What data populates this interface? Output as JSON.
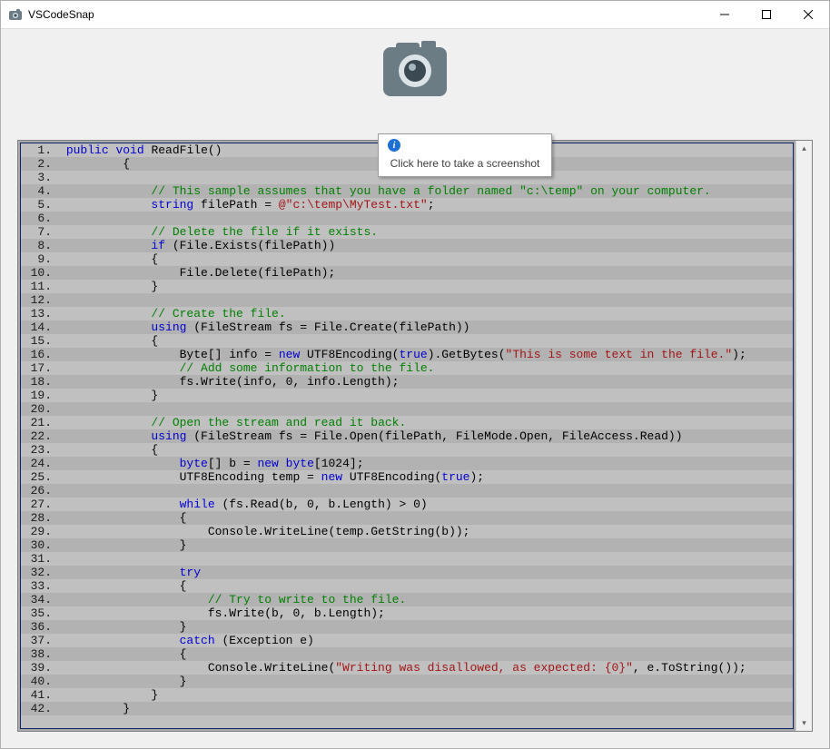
{
  "window": {
    "title": "VSCodeSnap"
  },
  "tooltip": {
    "text": "Click here to take a screenshot"
  },
  "code": {
    "lines": [
      {
        "n": 1,
        "tokens": [
          {
            "t": " ",
            "c": ""
          },
          {
            "t": "public",
            "c": "kw"
          },
          {
            "t": " ",
            "c": ""
          },
          {
            "t": "void",
            "c": "kw"
          },
          {
            "t": " ReadFile()",
            "c": ""
          }
        ]
      },
      {
        "n": 2,
        "tokens": [
          {
            "t": "         {",
            "c": ""
          }
        ]
      },
      {
        "n": 3,
        "tokens": [
          {
            "t": "",
            "c": ""
          }
        ]
      },
      {
        "n": 4,
        "tokens": [
          {
            "t": "             ",
            "c": ""
          },
          {
            "t": "// This sample assumes that you have a folder named \"c:\\temp\" on your computer.",
            "c": "cm"
          }
        ]
      },
      {
        "n": 5,
        "tokens": [
          {
            "t": "             ",
            "c": ""
          },
          {
            "t": "string",
            "c": "kw"
          },
          {
            "t": " filePath = ",
            "c": ""
          },
          {
            "t": "@\"c:\\temp\\MyTest.txt\"",
            "c": "str"
          },
          {
            "t": ";",
            "c": ""
          }
        ]
      },
      {
        "n": 6,
        "tokens": [
          {
            "t": "",
            "c": ""
          }
        ]
      },
      {
        "n": 7,
        "tokens": [
          {
            "t": "             ",
            "c": ""
          },
          {
            "t": "// Delete the file if it exists.",
            "c": "cm"
          }
        ]
      },
      {
        "n": 8,
        "tokens": [
          {
            "t": "             ",
            "c": ""
          },
          {
            "t": "if",
            "c": "kw"
          },
          {
            "t": " (File.Exists(filePath))",
            "c": ""
          }
        ]
      },
      {
        "n": 9,
        "tokens": [
          {
            "t": "             {",
            "c": ""
          }
        ]
      },
      {
        "n": 10,
        "tokens": [
          {
            "t": "                 File.Delete(filePath);",
            "c": ""
          }
        ]
      },
      {
        "n": 11,
        "tokens": [
          {
            "t": "             }",
            "c": ""
          }
        ]
      },
      {
        "n": 12,
        "tokens": [
          {
            "t": "",
            "c": ""
          }
        ]
      },
      {
        "n": 13,
        "tokens": [
          {
            "t": "             ",
            "c": ""
          },
          {
            "t": "// Create the file.",
            "c": "cm"
          }
        ]
      },
      {
        "n": 14,
        "tokens": [
          {
            "t": "             ",
            "c": ""
          },
          {
            "t": "using",
            "c": "kw"
          },
          {
            "t": " (FileStream fs = File.Create(filePath))",
            "c": ""
          }
        ]
      },
      {
        "n": 15,
        "tokens": [
          {
            "t": "             {",
            "c": ""
          }
        ]
      },
      {
        "n": 16,
        "tokens": [
          {
            "t": "                 Byte[] info = ",
            "c": ""
          },
          {
            "t": "new",
            "c": "kw"
          },
          {
            "t": " UTF8Encoding(",
            "c": ""
          },
          {
            "t": "true",
            "c": "kw"
          },
          {
            "t": ").GetBytes(",
            "c": ""
          },
          {
            "t": "\"This is some text in the file.\"",
            "c": "str"
          },
          {
            "t": ");",
            "c": ""
          }
        ]
      },
      {
        "n": 17,
        "tokens": [
          {
            "t": "                 ",
            "c": ""
          },
          {
            "t": "// Add some information to the file.",
            "c": "cm"
          }
        ]
      },
      {
        "n": 18,
        "tokens": [
          {
            "t": "                 fs.Write(info, 0, info.Length);",
            "c": ""
          }
        ]
      },
      {
        "n": 19,
        "tokens": [
          {
            "t": "             }",
            "c": ""
          }
        ]
      },
      {
        "n": 20,
        "tokens": [
          {
            "t": "",
            "c": ""
          }
        ]
      },
      {
        "n": 21,
        "tokens": [
          {
            "t": "             ",
            "c": ""
          },
          {
            "t": "// Open the stream and read it back.",
            "c": "cm"
          }
        ]
      },
      {
        "n": 22,
        "tokens": [
          {
            "t": "             ",
            "c": ""
          },
          {
            "t": "using",
            "c": "kw"
          },
          {
            "t": " (FileStream fs = File.Open(filePath, FileMode.Open, FileAccess.Read))",
            "c": ""
          }
        ]
      },
      {
        "n": 23,
        "tokens": [
          {
            "t": "             {",
            "c": ""
          }
        ]
      },
      {
        "n": 24,
        "tokens": [
          {
            "t": "                 ",
            "c": ""
          },
          {
            "t": "byte",
            "c": "kw"
          },
          {
            "t": "[] b = ",
            "c": ""
          },
          {
            "t": "new",
            "c": "kw"
          },
          {
            "t": " ",
            "c": ""
          },
          {
            "t": "byte",
            "c": "kw"
          },
          {
            "t": "[1024];",
            "c": ""
          }
        ]
      },
      {
        "n": 25,
        "tokens": [
          {
            "t": "                 UTF8Encoding temp = ",
            "c": ""
          },
          {
            "t": "new",
            "c": "kw"
          },
          {
            "t": " UTF8Encoding(",
            "c": ""
          },
          {
            "t": "true",
            "c": "kw"
          },
          {
            "t": ");",
            "c": ""
          }
        ]
      },
      {
        "n": 26,
        "tokens": [
          {
            "t": "",
            "c": ""
          }
        ]
      },
      {
        "n": 27,
        "tokens": [
          {
            "t": "                 ",
            "c": ""
          },
          {
            "t": "while",
            "c": "kw"
          },
          {
            "t": " (fs.Read(b, 0, b.Length) > 0)",
            "c": ""
          }
        ]
      },
      {
        "n": 28,
        "tokens": [
          {
            "t": "                 {",
            "c": ""
          }
        ]
      },
      {
        "n": 29,
        "tokens": [
          {
            "t": "                     Console.WriteLine(temp.GetString(b));",
            "c": ""
          }
        ]
      },
      {
        "n": 30,
        "tokens": [
          {
            "t": "                 }",
            "c": ""
          }
        ]
      },
      {
        "n": 31,
        "tokens": [
          {
            "t": "",
            "c": ""
          }
        ]
      },
      {
        "n": 32,
        "tokens": [
          {
            "t": "                 ",
            "c": ""
          },
          {
            "t": "try",
            "c": "kw"
          }
        ]
      },
      {
        "n": 33,
        "tokens": [
          {
            "t": "                 {",
            "c": ""
          }
        ]
      },
      {
        "n": 34,
        "tokens": [
          {
            "t": "                     ",
            "c": ""
          },
          {
            "t": "// Try to write to the file.",
            "c": "cm"
          }
        ]
      },
      {
        "n": 35,
        "tokens": [
          {
            "t": "                     fs.Write(b, 0, b.Length);",
            "c": ""
          }
        ]
      },
      {
        "n": 36,
        "tokens": [
          {
            "t": "                 }",
            "c": ""
          }
        ]
      },
      {
        "n": 37,
        "tokens": [
          {
            "t": "                 ",
            "c": ""
          },
          {
            "t": "catch",
            "c": "kw"
          },
          {
            "t": " (Exception e)",
            "c": ""
          }
        ]
      },
      {
        "n": 38,
        "tokens": [
          {
            "t": "                 {",
            "c": ""
          }
        ]
      },
      {
        "n": 39,
        "tokens": [
          {
            "t": "                     Console.WriteLine(",
            "c": ""
          },
          {
            "t": "\"Writing was disallowed, as expected: {0}\"",
            "c": "str"
          },
          {
            "t": ", e.ToString());",
            "c": ""
          }
        ]
      },
      {
        "n": 40,
        "tokens": [
          {
            "t": "                 }",
            "c": ""
          }
        ]
      },
      {
        "n": 41,
        "tokens": [
          {
            "t": "             }",
            "c": ""
          }
        ]
      },
      {
        "n": 42,
        "tokens": [
          {
            "t": "         }",
            "c": ""
          }
        ]
      }
    ]
  }
}
